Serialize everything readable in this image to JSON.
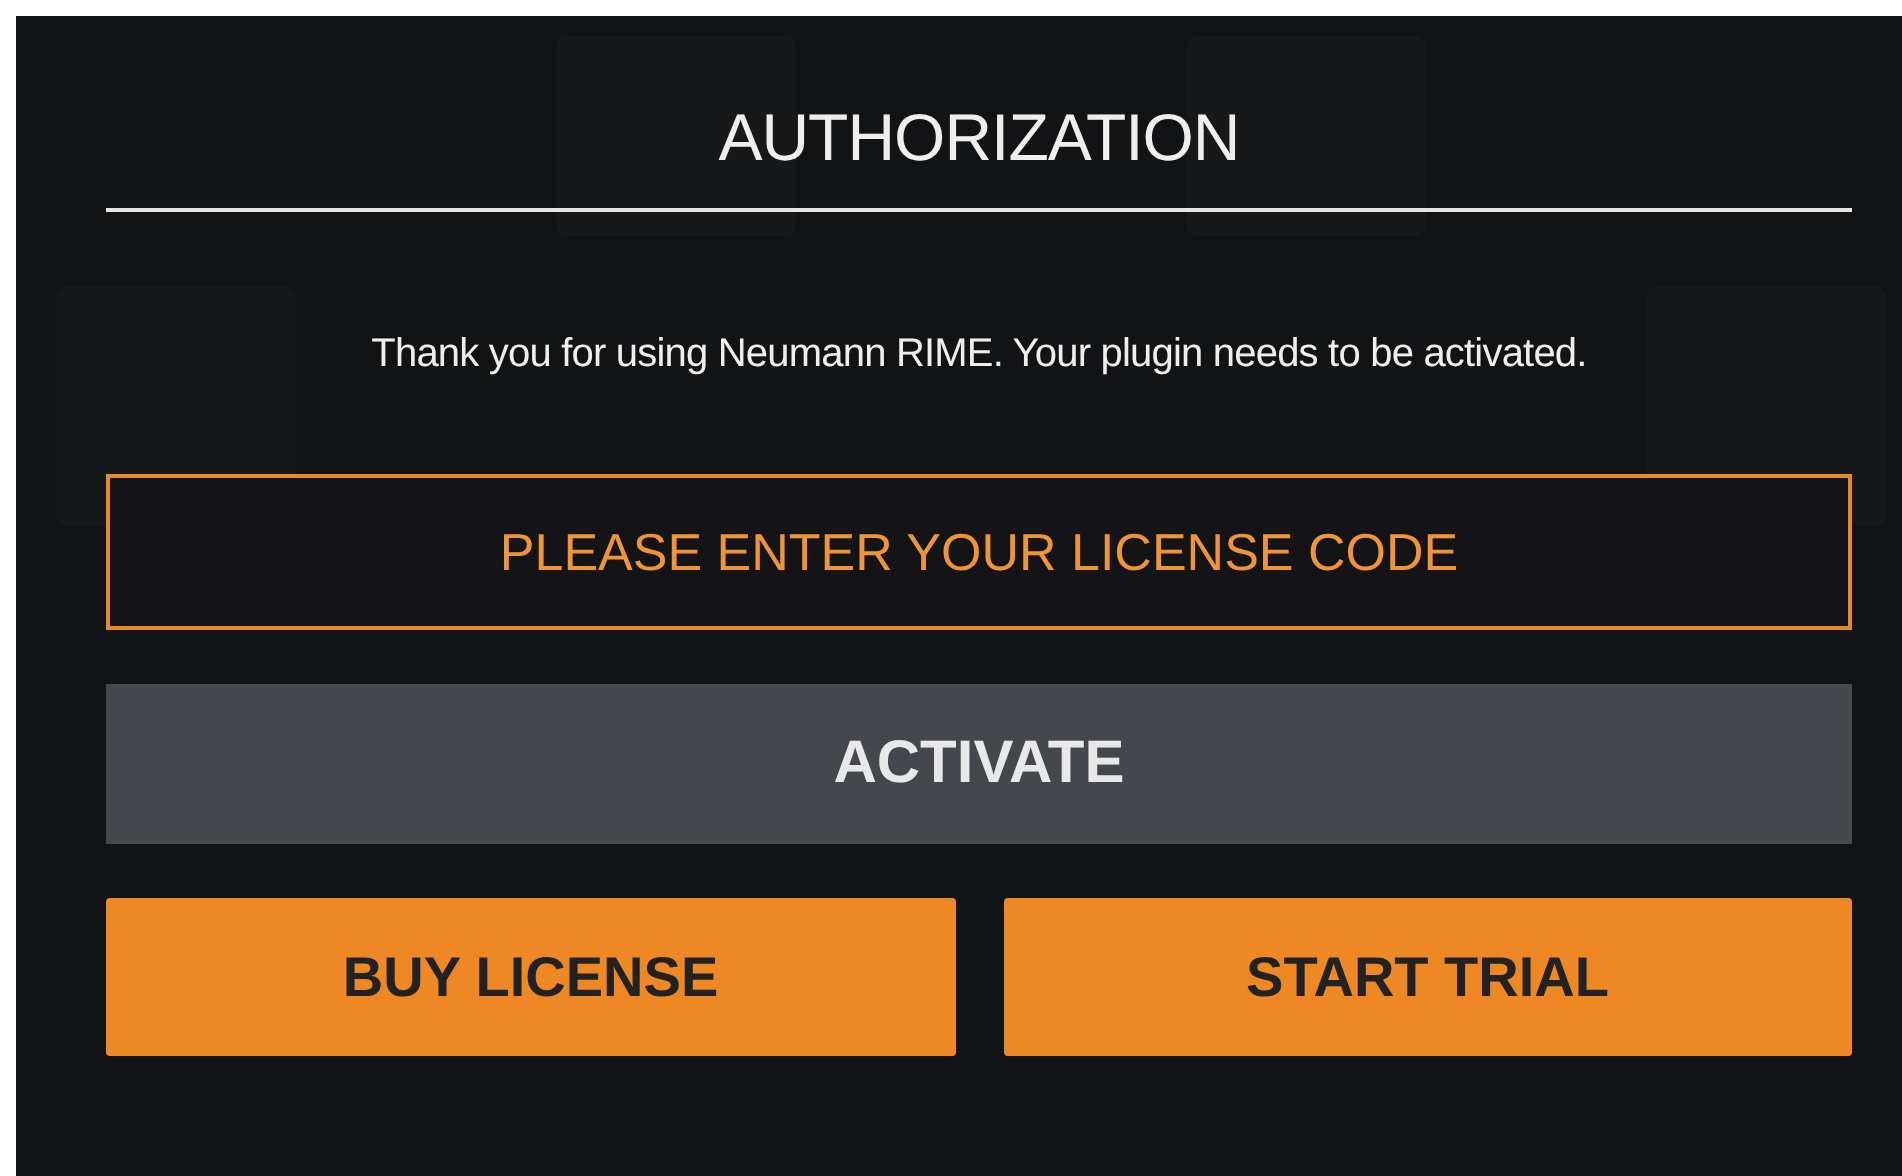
{
  "dialog": {
    "title": "AUTHORIZATION",
    "message": "Thank you for using Neumann RIME. Your plugin needs to be activated.",
    "license_field": {
      "placeholder": "PLEASE ENTER YOUR LICENSE CODE"
    },
    "activate_button": "ACTIVATE",
    "buttons": [
      "BUY LICENSE",
      "START TRIAL"
    ]
  }
}
